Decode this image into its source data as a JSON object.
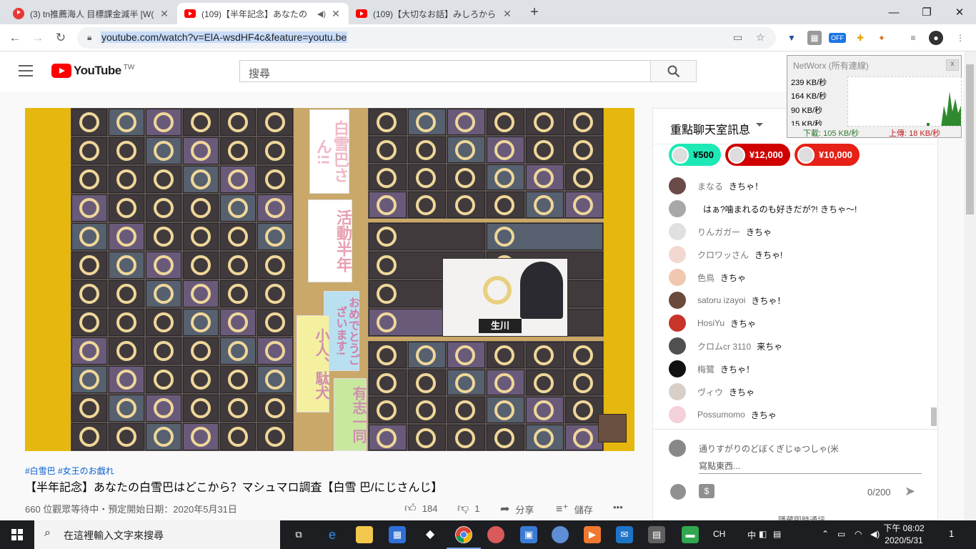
{
  "browser": {
    "tabs": [
      {
        "title": "(3) tn推薦海人 目標課金減半 [W(",
        "active": false
      },
      {
        "title": "(109)【半年記念】あなたの",
        "active": true
      },
      {
        "title": "(109)【大切なお話】みしろから",
        "active": false
      }
    ],
    "url": "youtube.com/watch?v=ElA-wsdHF4c&feature=youtu.be",
    "new_tab": "+",
    "window_controls": {
      "minimize": "—",
      "maximize": "❐",
      "close": "✕"
    },
    "extension_badge": "OFF"
  },
  "youtube": {
    "logo_text": "YouTube",
    "region": "TW",
    "search_placeholder": "搜尋"
  },
  "video": {
    "tags": "#白雪巴 #女王のお戯れ",
    "title": "【半年記念】あなたの白雪巴はどこから？マシュマロ調査【白雪 巴/にじさんじ】",
    "meta": "660 位觀眾等待中・預定開始日期：2020年5月31日",
    "likes": "184",
    "dislikes": "1",
    "share_label": "分享",
    "save_label": "儲存",
    "more": "•••",
    "board_notes": [
      "白雪巴さん!!",
      "活動半年",
      "おめでとうございます!",
      "小人、駄犬",
      "有志一同",
      "生川"
    ]
  },
  "chat": {
    "header": "重點聊天室訊息",
    "tickers": [
      {
        "amount": "¥500",
        "color": "#1de9b6",
        "text_color": "#000000"
      },
      {
        "amount": "¥12,000",
        "color": "#d00000",
        "text_color": "#ffffff"
      },
      {
        "amount": "¥10,000",
        "color": "#e62117",
        "text_color": "#ffffff"
      }
    ],
    "messages": [
      {
        "author": "まなる",
        "text": "きちゃ！",
        "avatar_color": "#6b4a4a"
      },
      {
        "author": "",
        "text": "はぁ?噛まれるのも好きだが?! きちゃ〜!",
        "avatar_color": "#a8a8a8"
      },
      {
        "author": "りんガガー",
        "text": "きちゃ",
        "avatar_color": "#e0e0e0"
      },
      {
        "author": "クロワッさん",
        "text": "きちゃ!",
        "avatar_color": "#f2d8d0"
      },
      {
        "author": "色鳥",
        "text": "きちゃ",
        "avatar_color": "#f0c8b0"
      },
      {
        "author": "satoru izayoi",
        "text": "きちゃ！",
        "avatar_color": "#6a4a3a"
      },
      {
        "author": "HosiYu",
        "text": "きちゃ",
        "avatar_color": "#c8342a"
      },
      {
        "author": "クロムcr 3110",
        "text": "来ちゃ",
        "avatar_color": "#505050"
      },
      {
        "author": "梅鷺",
        "text": "きちゃ！",
        "avatar_color": "#111111"
      },
      {
        "author": "ヴィウ",
        "text": "きちゃ",
        "avatar_color": "#d8d0c8"
      },
      {
        "author": "Possumomo",
        "text": "きちゃ",
        "avatar_color": "#f4d0d8"
      }
    ],
    "composer_name": "通りすがりのどぼくぎじゅつしゃ(米",
    "composer_placeholder": "寫點東西...",
    "char_count": "0/200",
    "bottom_text": "隱藏即時通訊"
  },
  "networx": {
    "title": "NetWorx (所有連線)",
    "scale": [
      "239 KB/秒",
      "164 KB/秒",
      "90 KB/秒",
      "15 KB/秒"
    ],
    "download": "下載: 105 KB/秒",
    "upload": "上傳: 18 KB/秒"
  },
  "taskbar": {
    "search_placeholder": "在這裡輸入文字來搜尋",
    "ime": "CH",
    "ime2": "中",
    "time": "下午 08:02",
    "date": "2020/5/31",
    "notifications": "1"
  }
}
